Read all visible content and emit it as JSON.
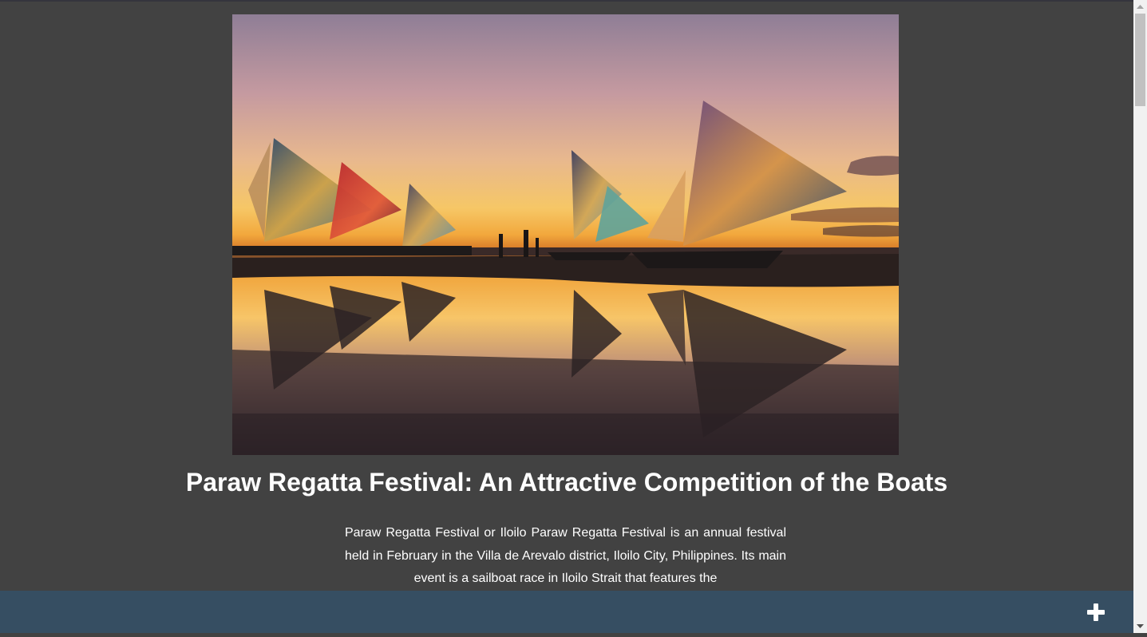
{
  "article": {
    "image_alt": "Paraw sailboats with colorful sails on a beach at sunset",
    "title": "Paraw Regatta Festival: An Attractive Competition of the Boats",
    "paragraph": "Paraw Regatta Festival or Iloilo Paraw Regatta Festival is an annual festival held in February in the Villa de Arevalo district, Iloilo City, Philippines. Its main event is a sailboat race in Iloilo Strait that features the"
  },
  "footer": {
    "button_icon": "plus-icon",
    "bar_color": "#364e62"
  },
  "colors": {
    "background": "#424242",
    "text": "#ffffff"
  }
}
